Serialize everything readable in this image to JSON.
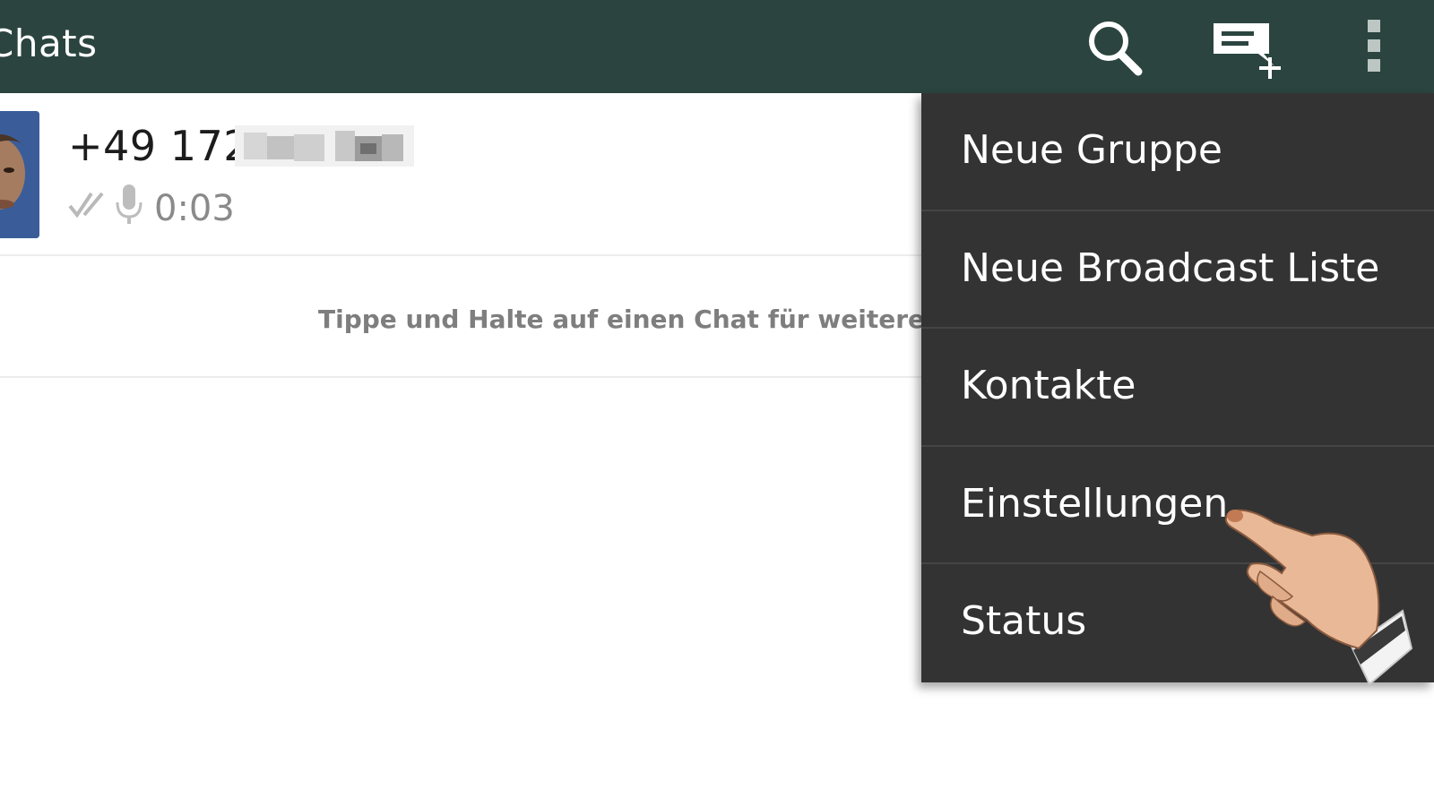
{
  "actionbar": {
    "title": "Chats",
    "icons": [
      "search-icon",
      "new-chat-icon",
      "overflow-menu-icon"
    ]
  },
  "chats": [
    {
      "name": "+49 172",
      "name_redacted": true,
      "last_message": {
        "status": "read",
        "type": "voice",
        "duration": "0:03"
      }
    }
  ],
  "hint": "Tippe und Halte auf einen Chat für weitere Opt",
  "menu": {
    "items": [
      {
        "label": "Neue Gruppe"
      },
      {
        "label": "Neue Broadcast Liste"
      },
      {
        "label": "Kontakte"
      },
      {
        "label": "Einstellungen"
      },
      {
        "label": "Status"
      }
    ]
  },
  "colors": {
    "actionbar": "#2b443f",
    "menu_bg": "#333333",
    "menu_divider": "#454545"
  }
}
